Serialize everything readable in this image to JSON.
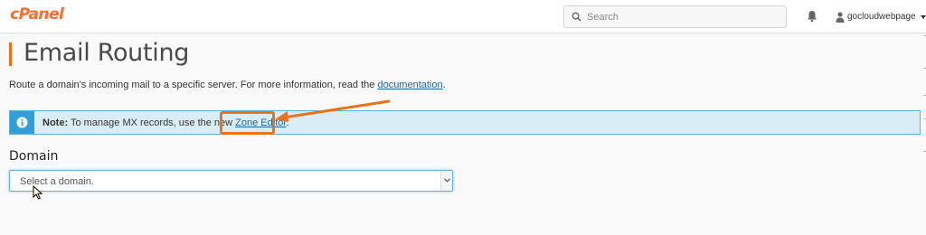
{
  "header": {
    "logo": "cPanel",
    "search_placeholder": "Search",
    "username": "gocloudwebpage"
  },
  "page": {
    "title": "Email Routing",
    "description_prefix": "Route a domain's incoming mail to a specific server. For more information, read the ",
    "description_link": "documentation",
    "description_suffix": "."
  },
  "note": {
    "label": "Note:",
    "text": " To manage MX records, use the new ",
    "link": "Zone Editor",
    "suffix": "."
  },
  "domain": {
    "label": "Domain",
    "select_value": "Select a domain."
  },
  "colors": {
    "accent": "#e8731e",
    "brand": "#ff6c2c",
    "info": "#2f9fd6",
    "link": "#2a6496"
  },
  "icons": [
    "search-icon",
    "bell-icon",
    "user-icon",
    "info-icon",
    "chevron-down-icon"
  ]
}
